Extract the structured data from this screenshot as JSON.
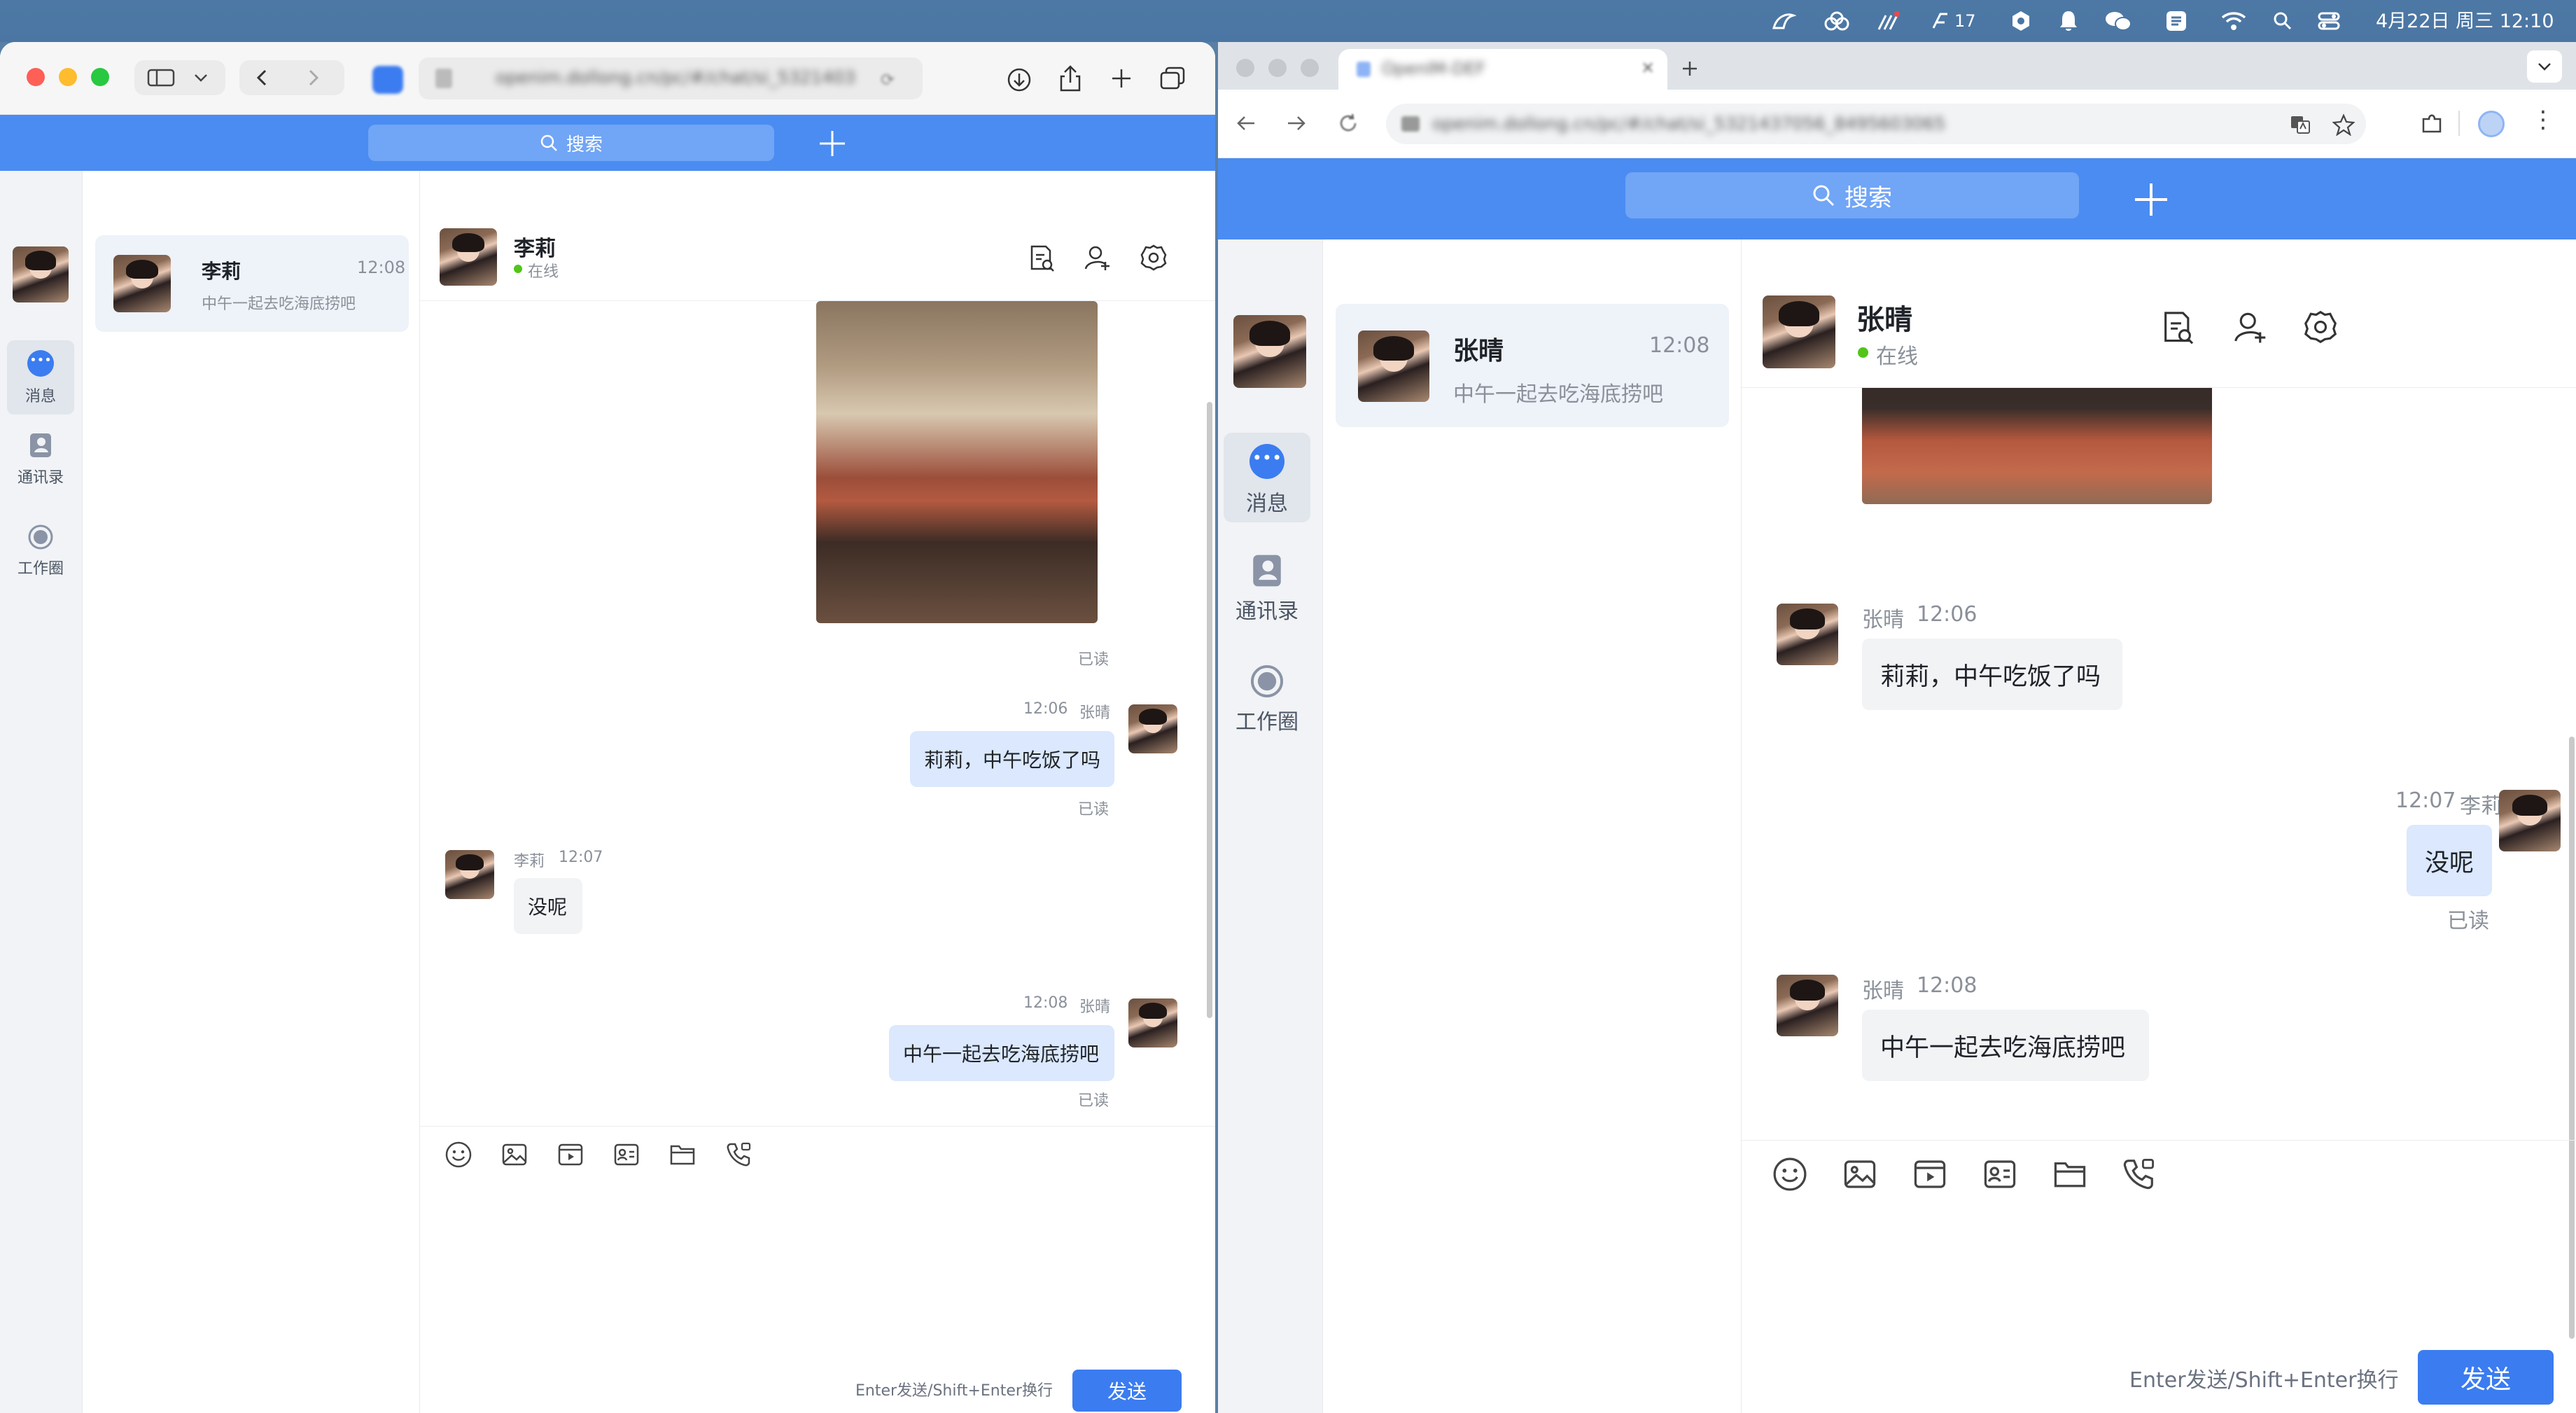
{
  "menubar": {
    "icons": [
      "bird-icon",
      "cloud-icon",
      "stats-icon",
      "notification-icon",
      "sync-icon",
      "bell-icon",
      "wechat-icon",
      "app-icon",
      "wifi-icon",
      "search-icon",
      "control-center-icon"
    ],
    "notification_count": "17",
    "datetime": "4月22日 周三  12:10"
  },
  "left_window": {
    "url": "openim.dollong.cn/pc/#/chat/si_5321403",
    "search_placeholder": "搜索",
    "rail": {
      "messages": "消息",
      "contacts": "通讯录",
      "workspace": "工作圈"
    },
    "conversation": {
      "name": "李莉",
      "time": "12:08",
      "preview": "中午一起去吃海底捞吧"
    },
    "chat_header": {
      "name": "李莉",
      "status": "在线"
    },
    "messages": [
      {
        "read": "已读"
      },
      {
        "time": "12:06",
        "sender": "张晴",
        "text": "莉莉，中午吃饭了吗",
        "read": "已读"
      },
      {
        "time": "12:07",
        "sender": "李莉",
        "text": "没呢"
      },
      {
        "time": "12:08",
        "sender": "张晴",
        "text": "中午一起去吃海底捞吧",
        "read": "已读"
      }
    ],
    "hint": "Enter发送/Shift+Enter换行",
    "send": "发送"
  },
  "right_window": {
    "tab_title": "OpenIM-DEF",
    "url": "openim.dollong.cn/pc/#/chat/si_5321437056_8495603065",
    "search_placeholder": "搜索",
    "rail": {
      "messages": "消息",
      "contacts": "通讯录",
      "workspace": "工作圈"
    },
    "conversation": {
      "name": "张晴",
      "time": "12:08",
      "preview": "中午一起去吃海底捞吧"
    },
    "chat_header": {
      "name": "张晴",
      "status": "在线"
    },
    "messages": [
      {
        "sender": "张晴",
        "time": "12:06",
        "text": "莉莉，中午吃饭了吗"
      },
      {
        "time": "12:07",
        "sender": "李莉",
        "text": "没呢",
        "read": "已读"
      },
      {
        "sender": "张晴",
        "time": "12:08",
        "text": "中午一起去吃海底捞吧"
      }
    ],
    "hint": "Enter发送/Shift+Enter换行",
    "send": "发送"
  },
  "colors": {
    "accent": "#4a8cf2",
    "send_button": "#3b7cf0",
    "bubble_me": "#dbe8fd",
    "bubble_other": "#f2f3f5",
    "online": "#52c41a"
  }
}
